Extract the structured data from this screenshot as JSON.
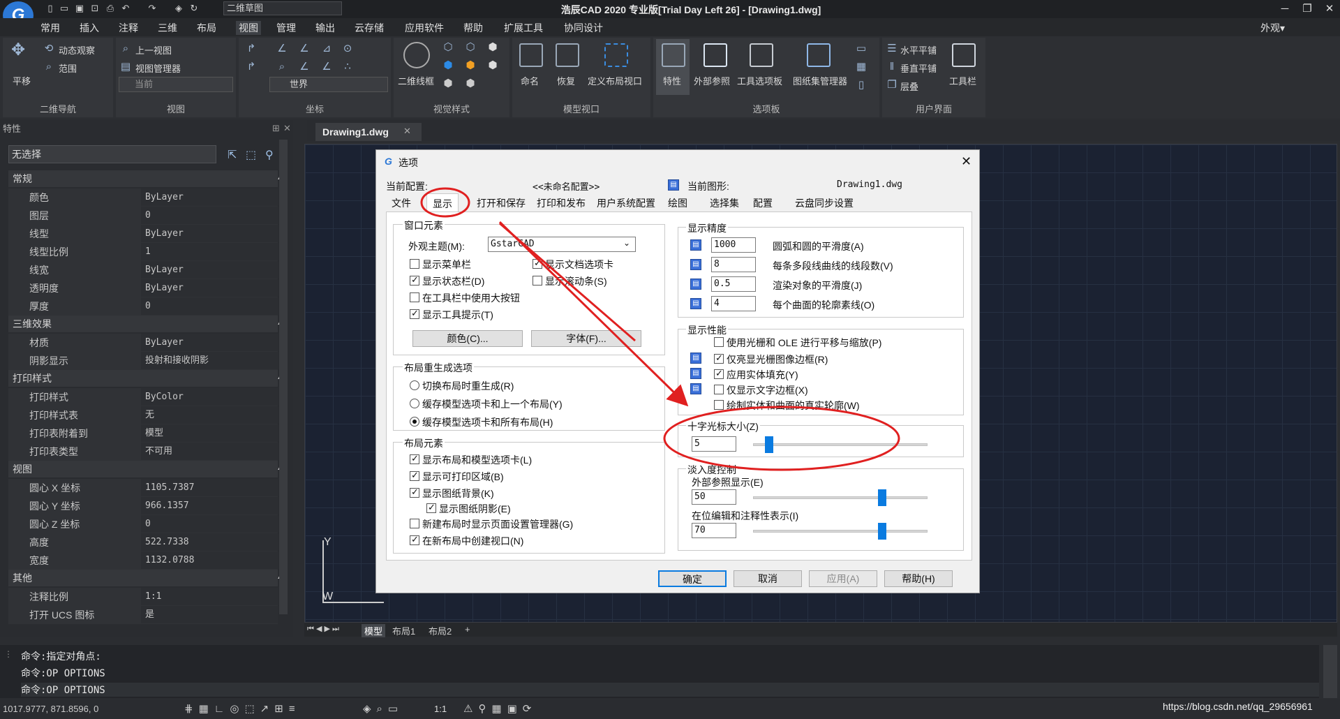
{
  "app": {
    "logo": "G",
    "title": "浩辰CAD 2020 专业版[Trial Day Left 26] - [Drawing1.dwg]",
    "workspace": "二维草图",
    "appearance_menu": "外观▾"
  },
  "menu": [
    "常用",
    "插入",
    "注释",
    "三维",
    "布局",
    "视图",
    "管理",
    "输出",
    "云存储",
    "应用软件",
    "帮助",
    "扩展工具",
    "协同设计"
  ],
  "ribbon": {
    "pan": "平移",
    "orbit": "动态观察",
    "range": "范围",
    "prev_view": "上一视图",
    "view_manager": "视图管理器",
    "current": "当前",
    "world": "世界",
    "wireframe": "二维线框",
    "name": "命名",
    "restore": "恢复",
    "define_viewport": "定义布局视口",
    "properties": "特性",
    "xref": "外部参照",
    "tool_palette": "工具选项板",
    "sheet_set": "图纸集管理器",
    "tile_h": "水平平铺",
    "tile_v": "垂直平铺",
    "cascade": "层叠",
    "toolbar": "工具栏",
    "groups": [
      "二维导航",
      "视图",
      "坐标",
      "视觉样式",
      "模型视口",
      "选项板",
      "用户界面"
    ]
  },
  "properties_panel": {
    "header": "特性",
    "selection": "无选择",
    "categories": [
      {
        "name": "常规",
        "rows": [
          [
            "颜色",
            "ByLayer"
          ],
          [
            "图层",
            "0"
          ],
          [
            "线型",
            "ByLayer"
          ],
          [
            "线型比例",
            "1"
          ],
          [
            "线宽",
            "ByLayer"
          ],
          [
            "透明度",
            "ByLayer"
          ],
          [
            "厚度",
            "0"
          ]
        ]
      },
      {
        "name": "三维效果",
        "rows": [
          [
            "材质",
            "ByLayer"
          ],
          [
            "阴影显示",
            "投射和接收阴影"
          ]
        ]
      },
      {
        "name": "打印样式",
        "rows": [
          [
            "打印样式",
            "ByColor"
          ],
          [
            "打印样式表",
            "无"
          ],
          [
            "打印表附着到",
            "模型"
          ],
          [
            "打印表类型",
            "不可用"
          ]
        ]
      },
      {
        "name": "视图",
        "rows": [
          [
            "圆心 X 坐标",
            "1105.7387"
          ],
          [
            "圆心 Y 坐标",
            "966.1357"
          ],
          [
            "圆心 Z 坐标",
            "0"
          ],
          [
            "高度",
            "522.7338"
          ],
          [
            "宽度",
            "1132.0788"
          ]
        ]
      },
      {
        "name": "其他",
        "rows": [
          [
            "注释比例",
            "1:1"
          ],
          [
            "打开 UCS 图标",
            "是"
          ]
        ]
      }
    ]
  },
  "doc_tab": "Drawing1.dwg",
  "layout_tabs": [
    "模型",
    "布局1",
    "布局2",
    "+"
  ],
  "ucs": {
    "y": "Y",
    "w": "W"
  },
  "command_lines": [
    "命令:指定对角点:",
    "命令:OP OPTIONS",
    "命令:OP OPTIONS"
  ],
  "status": {
    "coords": "1017.9777, 871.8596, 0",
    "scale": "1:1",
    "watermark": "https://blog.csdn.net/qq_29656961"
  },
  "dialog": {
    "title": "选项",
    "current_profile_label": "当前配置:",
    "current_profile": "<<未命名配置>>",
    "current_drawing_label": "当前图形:",
    "current_drawing": "Drawing1.dwg",
    "tabs": [
      "文件",
      "显示",
      "打开和保存",
      "打印和发布",
      "用户系统配置",
      "绘图",
      "选择集",
      "配置",
      "云盘同步设置"
    ],
    "window_elements": {
      "title": "窗口元素",
      "theme_label": "外观主题(M):",
      "theme_value": "GstarCAD",
      "checks": [
        {
          "label": "显示菜单栏",
          "checked": false
        },
        {
          "label": "显示文档选项卡",
          "checked": true
        },
        {
          "label": "显示状态栏(D)",
          "checked": true
        },
        {
          "label": "显示滚动条(S)",
          "checked": false
        },
        {
          "label": "在工具栏中使用大按钮",
          "checked": false
        },
        {
          "label": "显示工具提示(T)",
          "checked": true
        }
      ],
      "color_btn": "颜色(C)...",
      "font_btn": "字体(F)..."
    },
    "regen": {
      "title": "布局重生成选项",
      "options": [
        {
          "label": "切换布局时重生成(R)",
          "selected": false
        },
        {
          "label": "缓存模型选项卡和上一个布局(Y)",
          "selected": false
        },
        {
          "label": "缓存模型选项卡和所有布局(H)",
          "selected": true
        }
      ]
    },
    "layout_elements": {
      "title": "布局元素",
      "checks": [
        {
          "label": "显示布局和模型选项卡(L)",
          "checked": true
        },
        {
          "label": "显示可打印区域(B)",
          "checked": true
        },
        {
          "label": "显示图纸背景(K)",
          "checked": true
        },
        {
          "label": "显示图纸阴影(E)",
          "checked": true
        },
        {
          "label": "新建布局时显示页面设置管理器(G)",
          "checked": false
        },
        {
          "label": "在新布局中创建视口(N)",
          "checked": true
        }
      ]
    },
    "resolution": {
      "title": "显示精度",
      "rows": [
        {
          "value": "1000",
          "label": "圆弧和圆的平滑度(A)"
        },
        {
          "value": "8",
          "label": "每条多段线曲线的线段数(V)"
        },
        {
          "value": "0.5",
          "label": "渲染对象的平滑度(J)"
        },
        {
          "value": "4",
          "label": "每个曲面的轮廓素线(O)"
        }
      ]
    },
    "performance": {
      "title": "显示性能",
      "checks": [
        {
          "label": "使用光栅和 OLE 进行平移与缩放(P)",
          "checked": false
        },
        {
          "label": "仅亮显光栅图像边框(R)",
          "checked": true
        },
        {
          "label": "应用实体填充(Y)",
          "checked": true
        },
        {
          "label": "仅显示文字边框(X)",
          "checked": false
        },
        {
          "label": "绘制实体和曲面的真实轮廓(W)",
          "checked": false
        }
      ]
    },
    "crosshair": {
      "title": "十字光标大小(Z)",
      "value": "5",
      "fraction": 0.07
    },
    "fade": {
      "title": "淡入度控制",
      "xref_label": "外部参照显示(E)",
      "xref_value": "50",
      "xref_fraction": 0.75,
      "inplace_label": "在位编辑和注释性表示(I)",
      "inplace_value": "70",
      "inplace_fraction": 0.75
    },
    "buttons": {
      "ok": "确定",
      "cancel": "取消",
      "apply": "应用(A)",
      "help": "帮助(H)"
    }
  },
  "colors": {
    "accent": "#0a7be0",
    "annotation": "#e02020",
    "canvas": "#1b2232"
  }
}
